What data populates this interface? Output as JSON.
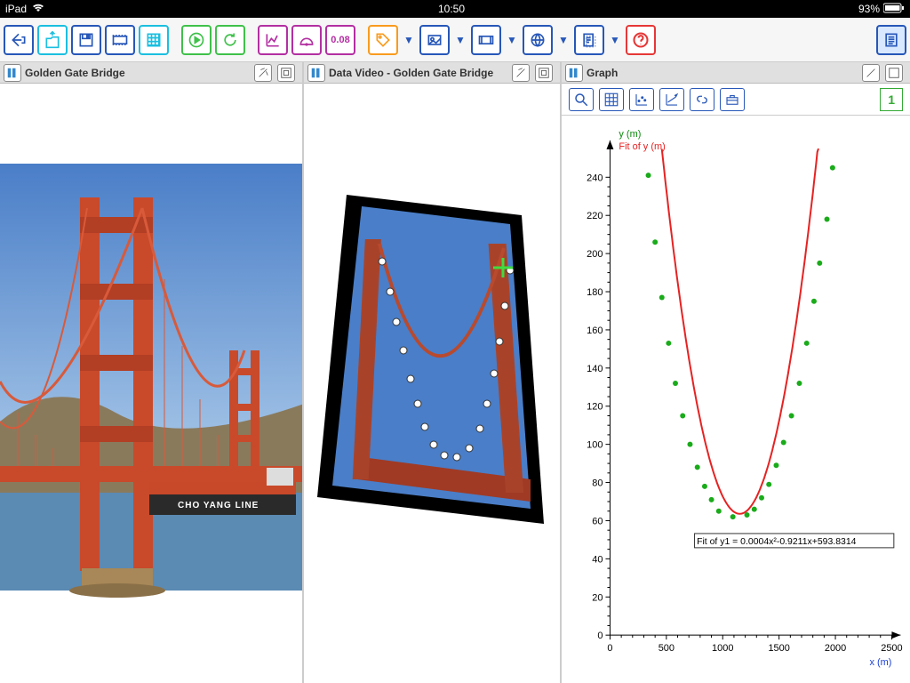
{
  "status": {
    "device": "iPad",
    "time": "10:50",
    "battery": "93%"
  },
  "toolbar": {
    "num_display": "0.08"
  },
  "panels": {
    "p1_title": "Golden Gate Bridge",
    "p1_ship": "CHO YANG LINE",
    "p2_title": "Data Video - Golden Gate Bridge",
    "p3_title": "Graph",
    "graph_id": "1"
  },
  "chart_data": {
    "type": "scatter",
    "title": "",
    "xlabel": "x (m)",
    "ylabel": "y (m)",
    "legend": [
      "y (m)",
      "Fit of  y (m)"
    ],
    "fit_label": "Fit of  y1 = 0.0004x²-0.9211x+593.8314",
    "fit": {
      "a": 0.0004,
      "b": -0.9211,
      "c": 593.8314
    },
    "xlim": [
      0,
      2500
    ],
    "ylim": [
      0,
      250
    ],
    "xticks": [
      0,
      500,
      1000,
      1500,
      2000,
      2500
    ],
    "yticks": [
      0,
      20,
      40,
      60,
      80,
      100,
      120,
      140,
      160,
      180,
      200,
      220,
      240
    ],
    "points": [
      {
        "x": 340,
        "y": 241
      },
      {
        "x": 400,
        "y": 206
      },
      {
        "x": 460,
        "y": 177
      },
      {
        "x": 520,
        "y": 153
      },
      {
        "x": 580,
        "y": 132
      },
      {
        "x": 645,
        "y": 115
      },
      {
        "x": 710,
        "y": 100
      },
      {
        "x": 775,
        "y": 88
      },
      {
        "x": 840,
        "y": 78
      },
      {
        "x": 900,
        "y": 71
      },
      {
        "x": 965,
        "y": 65
      },
      {
        "x": 1090,
        "y": 62
      },
      {
        "x": 1215,
        "y": 63
      },
      {
        "x": 1280,
        "y": 66
      },
      {
        "x": 1345,
        "y": 72
      },
      {
        "x": 1410,
        "y": 79
      },
      {
        "x": 1475,
        "y": 89
      },
      {
        "x": 1540,
        "y": 101
      },
      {
        "x": 1610,
        "y": 115
      },
      {
        "x": 1680,
        "y": 132
      },
      {
        "x": 1745,
        "y": 153
      },
      {
        "x": 1810,
        "y": 175
      },
      {
        "x": 1860,
        "y": 195
      },
      {
        "x": 1925,
        "y": 218
      },
      {
        "x": 1975,
        "y": 245
      }
    ]
  }
}
